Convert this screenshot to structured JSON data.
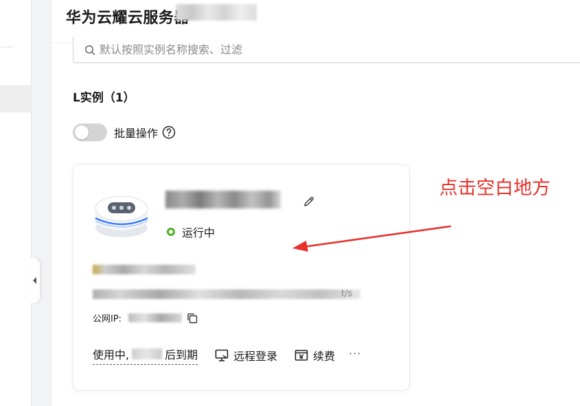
{
  "header": {
    "title": "华为云耀云服务器"
  },
  "search": {
    "placeholder": "默认按照实例名称搜索、过滤",
    "value": ""
  },
  "section": {
    "title": "L实例（1）"
  },
  "bulk": {
    "toggle_on": false,
    "label": "批量操作"
  },
  "card": {
    "status": {
      "text": "运行中",
      "color": "#4caf1f"
    },
    "bandwidth_suffix": "t/s",
    "ip_label": "公网IP:",
    "expiry_prefix": "使用中,",
    "expiry_suffix": "后到期",
    "actions": {
      "remote_login": "远程登录",
      "renew": "续费",
      "more": "···"
    }
  },
  "annotation": {
    "text": "点击空白地方",
    "color": "#e8302a"
  },
  "icons": {
    "search": "search-icon",
    "help": "help-icon",
    "edit": "edit-icon",
    "copy": "copy-icon",
    "remote": "monitor-icon",
    "renew": "yen-bill-icon",
    "collapse": "chevron-left-icon"
  }
}
